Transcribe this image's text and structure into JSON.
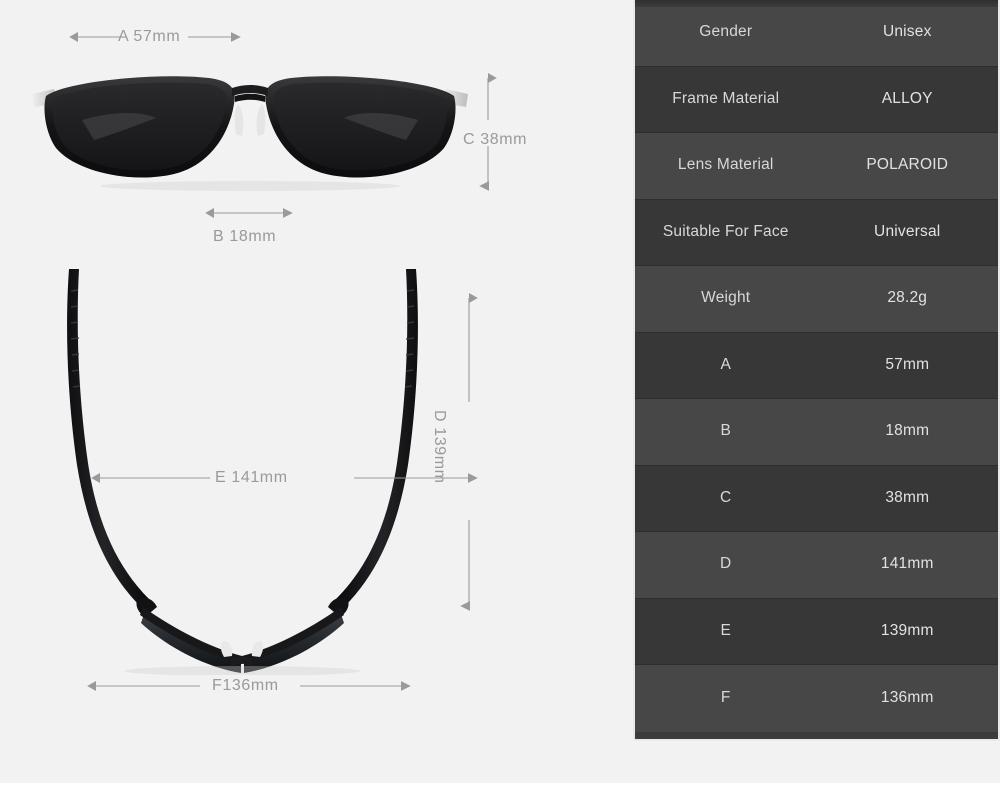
{
  "product": {
    "type": "sunglasses-dimension-spec-sheet"
  },
  "diagram": {
    "front_view_name": "sunglasses-front-view",
    "top_view_name": "sunglasses-top-view",
    "labels": {
      "a": "A 57mm",
      "b": "B 18mm",
      "c": "C 38mm",
      "d": "D 139mm",
      "e": "E 141mm",
      "f": "F136mm"
    }
  },
  "spec_table": {
    "rows": [
      {
        "key": "Gender",
        "value": "Unisex"
      },
      {
        "key": "Frame Material",
        "value": "ALLOY"
      },
      {
        "key": "Lens Material",
        "value": "POLAROID"
      },
      {
        "key": "Suitable For Face",
        "value": "Universal"
      },
      {
        "key": "Weight",
        "value": "28.2g"
      },
      {
        "key": "A",
        "value": "57mm"
      },
      {
        "key": "B",
        "value": "18mm"
      },
      {
        "key": "C",
        "value": "38mm"
      },
      {
        "key": "D",
        "value": "141mm"
      },
      {
        "key": "E",
        "value": "139mm"
      },
      {
        "key": "F",
        "value": "136mm"
      }
    ]
  },
  "colors": {
    "background": "#f2f2f2",
    "table_row_light": "#474747",
    "table_row_dark": "#373737",
    "table_text": "#d8d8d8",
    "dimension_text": "#9a9a9a",
    "frame_black": "#1b1b1b"
  }
}
